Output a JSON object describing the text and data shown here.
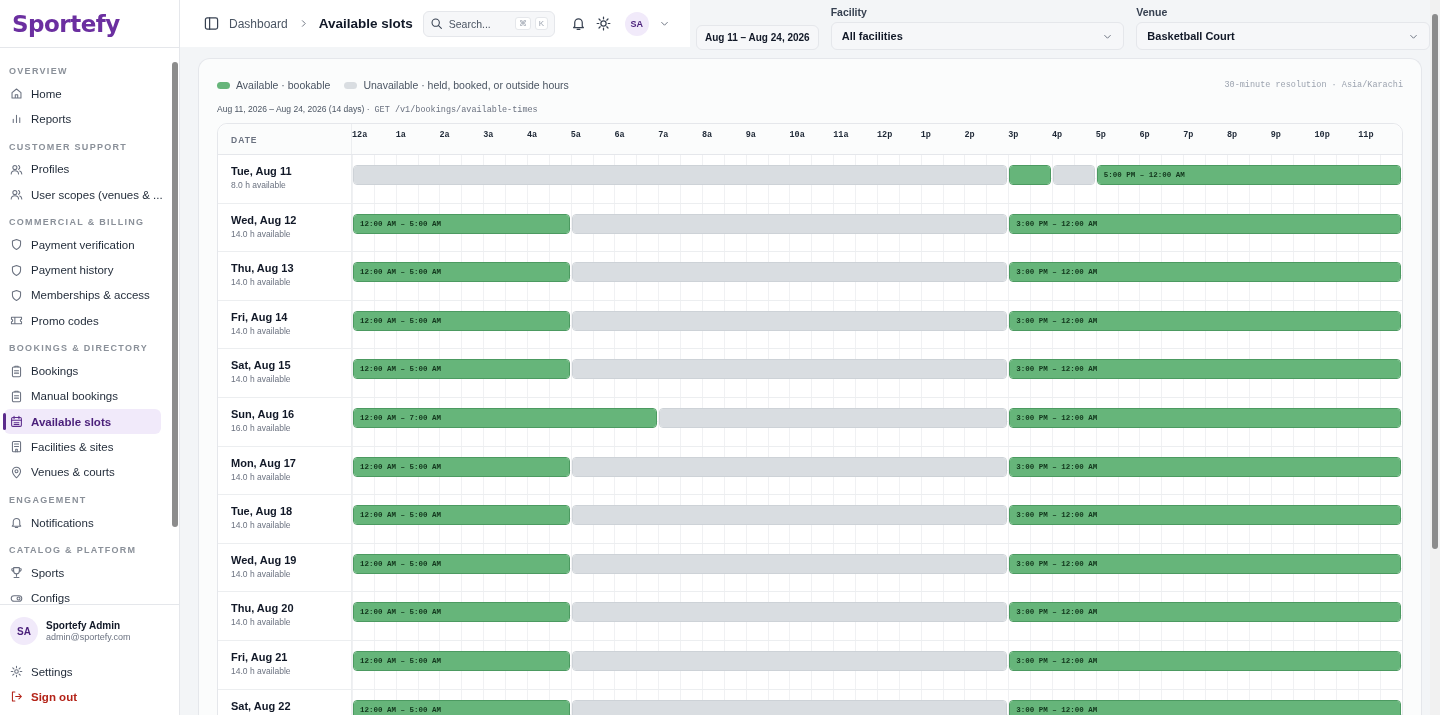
{
  "brand": {
    "name": "Sportefy"
  },
  "sidebar": {
    "sections": [
      {
        "title": "OVERVIEW",
        "items": [
          {
            "label": "Home",
            "selected": false
          },
          {
            "label": "Reports",
            "selected": false
          }
        ]
      },
      {
        "title": "CUSTOMER SUPPORT",
        "items": [
          {
            "label": "Profiles",
            "selected": false
          },
          {
            "label": "User scopes (venues & ...",
            "selected": false
          }
        ]
      },
      {
        "title": "COMMERCIAL & BILLING",
        "items": [
          {
            "label": "Payment verification",
            "selected": false
          },
          {
            "label": "Payment history",
            "selected": false
          },
          {
            "label": "Memberships & access",
            "selected": false
          },
          {
            "label": "Promo codes",
            "selected": false
          }
        ]
      },
      {
        "title": "BOOKINGS & DIRECTORY",
        "items": [
          {
            "label": "Bookings",
            "selected": false
          },
          {
            "label": "Manual bookings",
            "selected": false
          },
          {
            "label": "Available slots",
            "selected": true
          },
          {
            "label": "Facilities & sites",
            "selected": false
          },
          {
            "label": "Venues & courts",
            "selected": false
          }
        ]
      },
      {
        "title": "ENGAGEMENT",
        "items": [
          {
            "label": "Notifications",
            "selected": false
          }
        ]
      },
      {
        "title": "CATALOG & PLATFORM",
        "items": [
          {
            "label": "Sports",
            "selected": false
          },
          {
            "label": "Configs",
            "selected": false
          }
        ]
      }
    ]
  },
  "user": {
    "initials": "SA",
    "name": "Sportefy Admin",
    "email": "admin@sportefy.com"
  },
  "footer_items": [
    {
      "label": "Settings",
      "kind": "settings"
    },
    {
      "label": "Sign out",
      "kind": "signout"
    }
  ],
  "header": {
    "breadcrumb": "Dashboard",
    "title": "Available slots",
    "search": {
      "placeholder": "Search...",
      "shortcut": [
        "⌘",
        "K"
      ]
    },
    "avatar": "SA"
  },
  "filters": {
    "date_range": "Aug 11 – Aug 24, 2026",
    "facility": {
      "label": "Facility",
      "value": "All facilities"
    },
    "venue": {
      "label": "Venue",
      "value": "Basketball Court"
    }
  },
  "legend": [
    {
      "label": "Available · bookable",
      "kind": "available"
    },
    {
      "label": "Unavailable · held, booked, or outside hours",
      "kind": "unavailable"
    }
  ],
  "resolution": "30-minute resolution · Asia/Karachi",
  "summary": "Aug 11, 2026 – Aug 24, 2026 (14 days) ·",
  "endpoint": "GET /v1/bookings/available-times",
  "grid": {
    "date_header": "DATE",
    "hours": [
      "12a",
      "1a",
      "2a",
      "3a",
      "4a",
      "5a",
      "6a",
      "7a",
      "8a",
      "9a",
      "10a",
      "11a",
      "12p",
      "1p",
      "2p",
      "3p",
      "4p",
      "5p",
      "6p",
      "7p",
      "8p",
      "9p",
      "10p",
      "11p"
    ],
    "rows": [
      {
        "date": "Tue, Aug 11",
        "available": "8.0 h available",
        "hours": [
          {
            "available": false
          },
          {
            "available": false
          },
          {
            "available": false
          },
          {
            "available": false
          },
          {
            "available": false
          },
          {
            "available": false
          },
          {
            "available": false
          },
          {
            "available": false
          },
          {
            "available": false
          },
          {
            "available": false
          },
          {
            "available": false
          },
          {
            "available": false
          },
          {
            "available": false
          },
          {
            "available": false
          },
          {
            "available": false
          },
          {
            "available": true
          },
          {
            "available": false
          },
          {
            "available": true,
            "label": "5:00 PM – 12:00 AM"
          },
          {
            "available": true
          },
          {
            "available": true
          },
          {
            "available": true
          },
          {
            "available": true
          },
          {
            "available": true
          },
          {
            "available": true
          }
        ]
      },
      {
        "date": "Wed, Aug 12",
        "available": "14.0 h available",
        "hours": [
          {
            "available": true,
            "label": "12:00 AM – 5:00 AM"
          },
          {
            "available": true
          },
          {
            "available": true
          },
          {
            "available": true
          },
          {
            "available": true
          },
          {
            "available": false
          },
          {
            "available": false
          },
          {
            "available": false
          },
          {
            "available": false
          },
          {
            "available": false
          },
          {
            "available": false
          },
          {
            "available": false
          },
          {
            "available": false
          },
          {
            "available": false
          },
          {
            "available": false
          },
          {
            "available": true,
            "label": "3:00 PM – 12:00 AM"
          },
          {
            "available": true
          },
          {
            "available": true
          },
          {
            "available": true
          },
          {
            "available": true
          },
          {
            "available": true
          },
          {
            "available": true
          },
          {
            "available": true
          },
          {
            "available": true
          }
        ]
      },
      {
        "date": "Thu, Aug 13",
        "available": "14.0 h available",
        "hours": [
          {
            "available": true,
            "label": "12:00 AM – 5:00 AM"
          },
          {
            "available": true
          },
          {
            "available": true
          },
          {
            "available": true
          },
          {
            "available": true
          },
          {
            "available": false
          },
          {
            "available": false
          },
          {
            "available": false
          },
          {
            "available": false
          },
          {
            "available": false
          },
          {
            "available": false
          },
          {
            "available": false
          },
          {
            "available": false
          },
          {
            "available": false
          },
          {
            "available": false
          },
          {
            "available": true,
            "label": "3:00 PM – 12:00 AM"
          },
          {
            "available": true
          },
          {
            "available": true
          },
          {
            "available": true
          },
          {
            "available": true
          },
          {
            "available": true
          },
          {
            "available": true
          },
          {
            "available": true
          },
          {
            "available": true
          }
        ]
      },
      {
        "date": "Fri, Aug 14",
        "available": "14.0 h available",
        "hours": [
          {
            "available": true,
            "label": "12:00 AM – 5:00 AM"
          },
          {
            "available": true
          },
          {
            "available": true
          },
          {
            "available": true
          },
          {
            "available": true
          },
          {
            "available": false
          },
          {
            "available": false
          },
          {
            "available": false
          },
          {
            "available": false
          },
          {
            "available": false
          },
          {
            "available": false
          },
          {
            "available": false
          },
          {
            "available": false
          },
          {
            "available": false
          },
          {
            "available": false
          },
          {
            "available": true,
            "label": "3:00 PM – 12:00 AM"
          },
          {
            "available": true
          },
          {
            "available": true
          },
          {
            "available": true
          },
          {
            "available": true
          },
          {
            "available": true
          },
          {
            "available": true
          },
          {
            "available": true
          },
          {
            "available": true
          }
        ]
      },
      {
        "date": "Sat, Aug 15",
        "available": "14.0 h available",
        "hours": [
          {
            "available": true,
            "label": "12:00 AM – 5:00 AM"
          },
          {
            "available": true
          },
          {
            "available": true
          },
          {
            "available": true
          },
          {
            "available": true
          },
          {
            "available": false
          },
          {
            "available": false
          },
          {
            "available": false
          },
          {
            "available": false
          },
          {
            "available": false
          },
          {
            "available": false
          },
          {
            "available": false
          },
          {
            "available": false
          },
          {
            "available": false
          },
          {
            "available": false
          },
          {
            "available": true,
            "label": "3:00 PM – 12:00 AM"
          },
          {
            "available": true
          },
          {
            "available": true
          },
          {
            "available": true
          },
          {
            "available": true
          },
          {
            "available": true
          },
          {
            "available": true
          },
          {
            "available": true
          },
          {
            "available": true
          }
        ]
      },
      {
        "date": "Sun, Aug 16",
        "available": "16.0 h available",
        "hours": [
          {
            "available": true,
            "label": "12:00 AM – 7:00 AM"
          },
          {
            "available": true
          },
          {
            "available": true
          },
          {
            "available": true
          },
          {
            "available": true
          },
          {
            "available": true
          },
          {
            "available": true
          },
          {
            "available": false
          },
          {
            "available": false
          },
          {
            "available": false
          },
          {
            "available": false
          },
          {
            "available": false
          },
          {
            "available": false
          },
          {
            "available": false
          },
          {
            "available": false
          },
          {
            "available": true,
            "label": "3:00 PM – 12:00 AM"
          },
          {
            "available": true
          },
          {
            "available": true
          },
          {
            "available": true
          },
          {
            "available": true
          },
          {
            "available": true
          },
          {
            "available": true
          },
          {
            "available": true
          },
          {
            "available": true
          }
        ]
      },
      {
        "date": "Mon, Aug 17",
        "available": "14.0 h available",
        "hours": [
          {
            "available": true,
            "label": "12:00 AM – 5:00 AM"
          },
          {
            "available": true
          },
          {
            "available": true
          },
          {
            "available": true
          },
          {
            "available": true
          },
          {
            "available": false
          },
          {
            "available": false
          },
          {
            "available": false
          },
          {
            "available": false
          },
          {
            "available": false
          },
          {
            "available": false
          },
          {
            "available": false
          },
          {
            "available": false
          },
          {
            "available": false
          },
          {
            "available": false
          },
          {
            "available": true,
            "label": "3:00 PM – 12:00 AM"
          },
          {
            "available": true
          },
          {
            "available": true
          },
          {
            "available": true
          },
          {
            "available": true
          },
          {
            "available": true
          },
          {
            "available": true
          },
          {
            "available": true
          },
          {
            "available": true
          }
        ]
      },
      {
        "date": "Tue, Aug 18",
        "available": "14.0 h available",
        "hours": [
          {
            "available": true,
            "label": "12:00 AM – 5:00 AM"
          },
          {
            "available": true
          },
          {
            "available": true
          },
          {
            "available": true
          },
          {
            "available": true
          },
          {
            "available": false
          },
          {
            "available": false
          },
          {
            "available": false
          },
          {
            "available": false
          },
          {
            "available": false
          },
          {
            "available": false
          },
          {
            "available": false
          },
          {
            "available": false
          },
          {
            "available": false
          },
          {
            "available": false
          },
          {
            "available": true,
            "label": "3:00 PM – 12:00 AM"
          },
          {
            "available": true
          },
          {
            "available": true
          },
          {
            "available": true
          },
          {
            "available": true
          },
          {
            "available": true
          },
          {
            "available": true
          },
          {
            "available": true
          },
          {
            "available": true
          }
        ]
      },
      {
        "date": "Wed, Aug 19",
        "available": "14.0 h available",
        "hours": [
          {
            "available": true,
            "label": "12:00 AM – 5:00 AM"
          },
          {
            "available": true
          },
          {
            "available": true
          },
          {
            "available": true
          },
          {
            "available": true
          },
          {
            "available": false
          },
          {
            "available": false
          },
          {
            "available": false
          },
          {
            "available": false
          },
          {
            "available": false
          },
          {
            "available": false
          },
          {
            "available": false
          },
          {
            "available": false
          },
          {
            "available": false
          },
          {
            "available": false
          },
          {
            "available": true,
            "label": "3:00 PM – 12:00 AM"
          },
          {
            "available": true
          },
          {
            "available": true
          },
          {
            "available": true
          },
          {
            "available": true
          },
          {
            "available": true
          },
          {
            "available": true
          },
          {
            "available": true
          },
          {
            "available": true
          }
        ]
      },
      {
        "date": "Thu, Aug 20",
        "available": "14.0 h available",
        "hours": [
          {
            "available": true,
            "label": "12:00 AM – 5:00 AM"
          },
          {
            "available": true
          },
          {
            "available": true
          },
          {
            "available": true
          },
          {
            "available": true
          },
          {
            "available": false
          },
          {
            "available": false
          },
          {
            "available": false
          },
          {
            "available": false
          },
          {
            "available": false
          },
          {
            "available": false
          },
          {
            "available": false
          },
          {
            "available": false
          },
          {
            "available": false
          },
          {
            "available": false
          },
          {
            "available": true,
            "label": "3:00 PM – 12:00 AM"
          },
          {
            "available": true
          },
          {
            "available": true
          },
          {
            "available": true
          },
          {
            "available": true
          },
          {
            "available": true
          },
          {
            "available": true
          },
          {
            "available": true
          },
          {
            "available": true
          }
        ]
      },
      {
        "date": "Fri, Aug 21",
        "available": "14.0 h available",
        "hours": [
          {
            "available": true,
            "label": "12:00 AM – 5:00 AM"
          },
          {
            "available": true
          },
          {
            "available": true
          },
          {
            "available": true
          },
          {
            "available": true
          },
          {
            "available": false
          },
          {
            "available": false
          },
          {
            "available": false
          },
          {
            "available": false
          },
          {
            "available": false
          },
          {
            "available": false
          },
          {
            "available": false
          },
          {
            "available": false
          },
          {
            "available": false
          },
          {
            "available": false
          },
          {
            "available": true,
            "label": "3:00 PM – 12:00 AM"
          },
          {
            "available": true
          },
          {
            "available": true
          },
          {
            "available": true
          },
          {
            "available": true
          },
          {
            "available": true
          },
          {
            "available": true
          },
          {
            "available": true
          },
          {
            "available": true
          }
        ]
      },
      {
        "date": "Sat, Aug 22",
        "hours": [
          {
            "available": true,
            "label": "12:00 AM – 5:00 AM"
          },
          {
            "available": true
          },
          {
            "available": true
          },
          {
            "available": true
          },
          {
            "available": true
          },
          {
            "available": false
          },
          {
            "available": false
          },
          {
            "available": false
          },
          {
            "available": false
          },
          {
            "available": false
          },
          {
            "available": false
          },
          {
            "available": false
          },
          {
            "available": false
          },
          {
            "available": false
          },
          {
            "available": false
          },
          {
            "available": true,
            "label": "3:00 PM – 12:00 AM"
          },
          {
            "available": true
          },
          {
            "available": true
          },
          {
            "available": true
          },
          {
            "available": true
          },
          {
            "available": true
          },
          {
            "available": true
          },
          {
            "available": true
          },
          {
            "available": true
          }
        ]
      }
    ]
  }
}
